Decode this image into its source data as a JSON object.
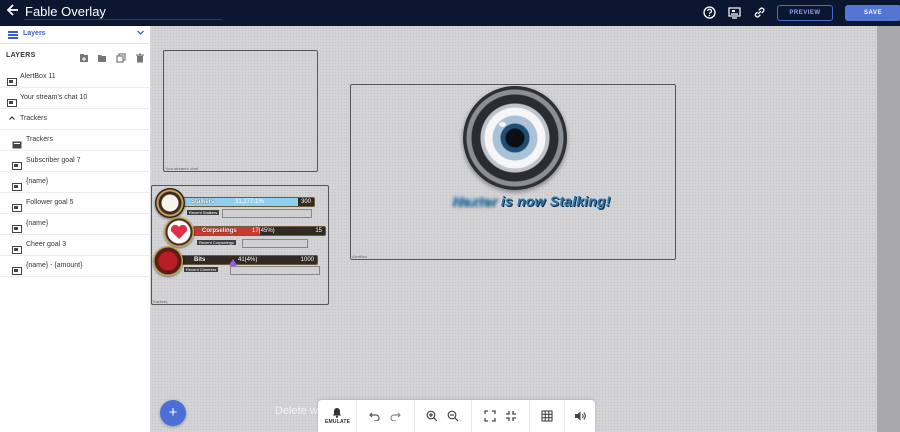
{
  "header": {
    "title": "Fable Overlay",
    "preview_label": "PREVIEW",
    "save_label": "SAVE",
    "icons": [
      "back-arrow-icon",
      "help-icon",
      "cast-icon",
      "link-icon"
    ]
  },
  "sidebar": {
    "dropdown_label": "Layers",
    "section_title": "LAYERS",
    "items": [
      {
        "label": "AlertBox 11",
        "icon": "widget-icon"
      },
      {
        "label": "Your stream's chat 10",
        "icon": "widget-icon"
      },
      {
        "label": "Trackers",
        "icon": "caret-up-icon"
      },
      {
        "label": "Trackers",
        "icon": "folder-icon"
      },
      {
        "label": "Subscriber goal 7",
        "icon": "widget-icon"
      },
      {
        "label": "{name}",
        "icon": "widget-icon"
      },
      {
        "label": "Follower goal 5",
        "icon": "widget-icon"
      },
      {
        "label": "{name}",
        "icon": "widget-icon"
      },
      {
        "label": "Cheer goal 3",
        "icon": "widget-icon"
      },
      {
        "label": "{name} - {amount}",
        "icon": "widget-icon"
      }
    ]
  },
  "canvas": {
    "chat_caption": "Your stream's chat",
    "alertbox_caption": "AlertBox",
    "trackers_caption": "Trackers",
    "alert": {
      "name_text": "Nexter",
      "message_text": " is now Stalking!"
    },
    "trackers": [
      {
        "label": "Stalkers",
        "mid": "31,277.1%",
        "value": "300",
        "color": "#8fd0ee",
        "progress": 0.88,
        "sub": "Recent Stalkers"
      },
      {
        "label": "Corpselings",
        "mid": "17(45%)",
        "value": "15",
        "color": "#c9392f",
        "progress": 0.5,
        "sub": "Recent Corpselings"
      },
      {
        "label": "Bits",
        "mid": "41(4%)",
        "value": "1000",
        "color": "#2a2622",
        "progress": 0.04,
        "sub": "Recent Cheerers"
      }
    ]
  },
  "bottom": {
    "ghost_text": "Delete w",
    "emulate_label": "EMULATE"
  },
  "colors": {
    "topbar": "#0b1631",
    "accent": "#5475d3",
    "canvas": "#d3d3d6"
  }
}
